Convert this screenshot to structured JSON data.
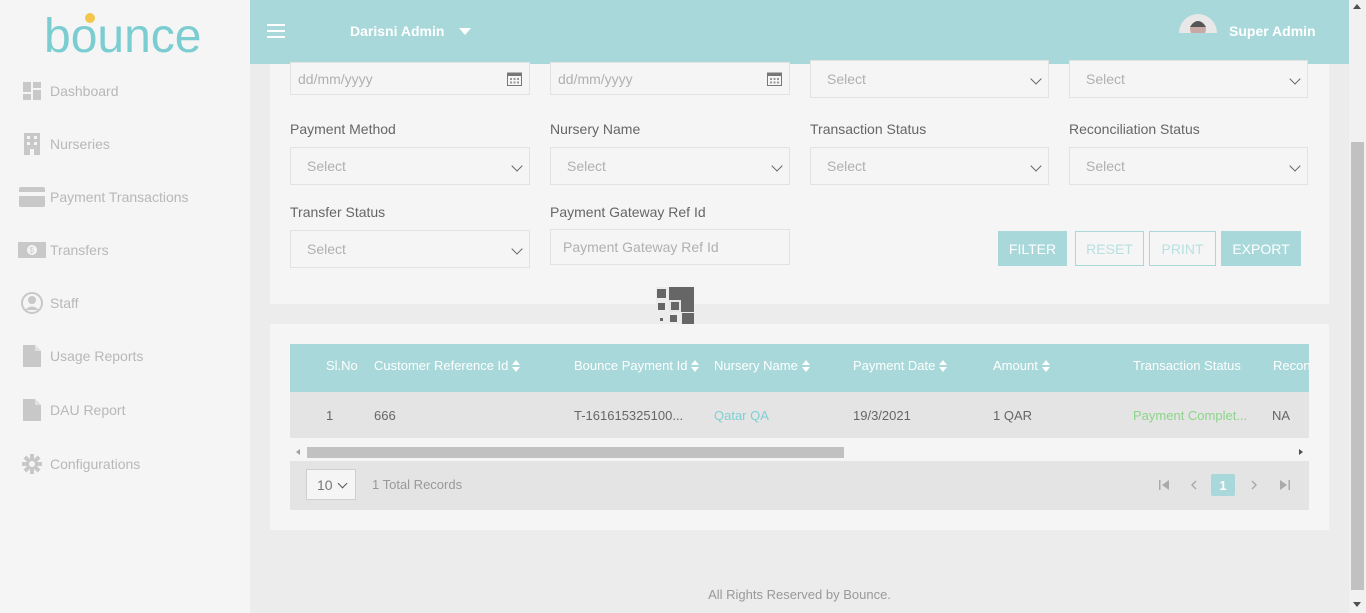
{
  "brand": {
    "logo_text": "bounce"
  },
  "sidebar": {
    "items": [
      {
        "label": "Dashboard",
        "icon": "dashboard-icon"
      },
      {
        "label": "Nurseries",
        "icon": "building-icon"
      },
      {
        "label": "Payment Transactions",
        "icon": "credit-card-icon"
      },
      {
        "label": "Transfers",
        "icon": "money-icon"
      },
      {
        "label": "Staff",
        "icon": "user-icon"
      },
      {
        "label": "Usage Reports",
        "icon": "document-icon"
      },
      {
        "label": "DAU Report",
        "icon": "document-icon"
      },
      {
        "label": "Configurations",
        "icon": "gear-icon"
      }
    ]
  },
  "header": {
    "org_name": "Darisni Admin",
    "user_name": "Super Admin"
  },
  "filters": {
    "date_from_placeholder": "dd/mm/yyyy",
    "date_to_placeholder": "dd/mm/yyyy",
    "top_select_3": "Select",
    "top_select_4": "Select",
    "payment_method": {
      "label": "Payment Method",
      "value": "Select"
    },
    "nursery_name": {
      "label": "Nursery Name",
      "value": "Select"
    },
    "transaction_status": {
      "label": "Transaction Status",
      "value": "Select"
    },
    "reconciliation_status": {
      "label": "Reconciliation Status",
      "value": "Select"
    },
    "transfer_status": {
      "label": "Transfer Status",
      "value": "Select"
    },
    "gateway_ref": {
      "label": "Payment Gateway Ref Id",
      "placeholder": "Payment Gateway Ref Id"
    }
  },
  "actions": {
    "filter": "FILTER",
    "reset": "RESET",
    "print": "PRINT",
    "export": "EXPORT"
  },
  "table": {
    "columns": [
      "Sl.No",
      "Customer Reference Id",
      "Bounce Payment Id",
      "Nursery Name",
      "Payment Date",
      "Amount",
      "Transaction Status",
      "Recon"
    ],
    "rows": [
      {
        "sl_no": "1",
        "customer_ref": "666",
        "bounce_payment_id": "T-161615325100...",
        "nursery_name": "Qatar QA",
        "payment_date": "19/3/2021",
        "amount": "1 QAR",
        "transaction_status": "Payment Complet...",
        "recon": "NA"
      }
    ]
  },
  "pagination": {
    "rows_per_page": "10",
    "total_records": "1 Total Records",
    "current_page": "1"
  },
  "footer": {
    "text": "All Rights Reserved by Bounce."
  },
  "colors": {
    "accent": "#a8d8da",
    "success": "#8bd58a",
    "link": "#7ed0d4"
  }
}
